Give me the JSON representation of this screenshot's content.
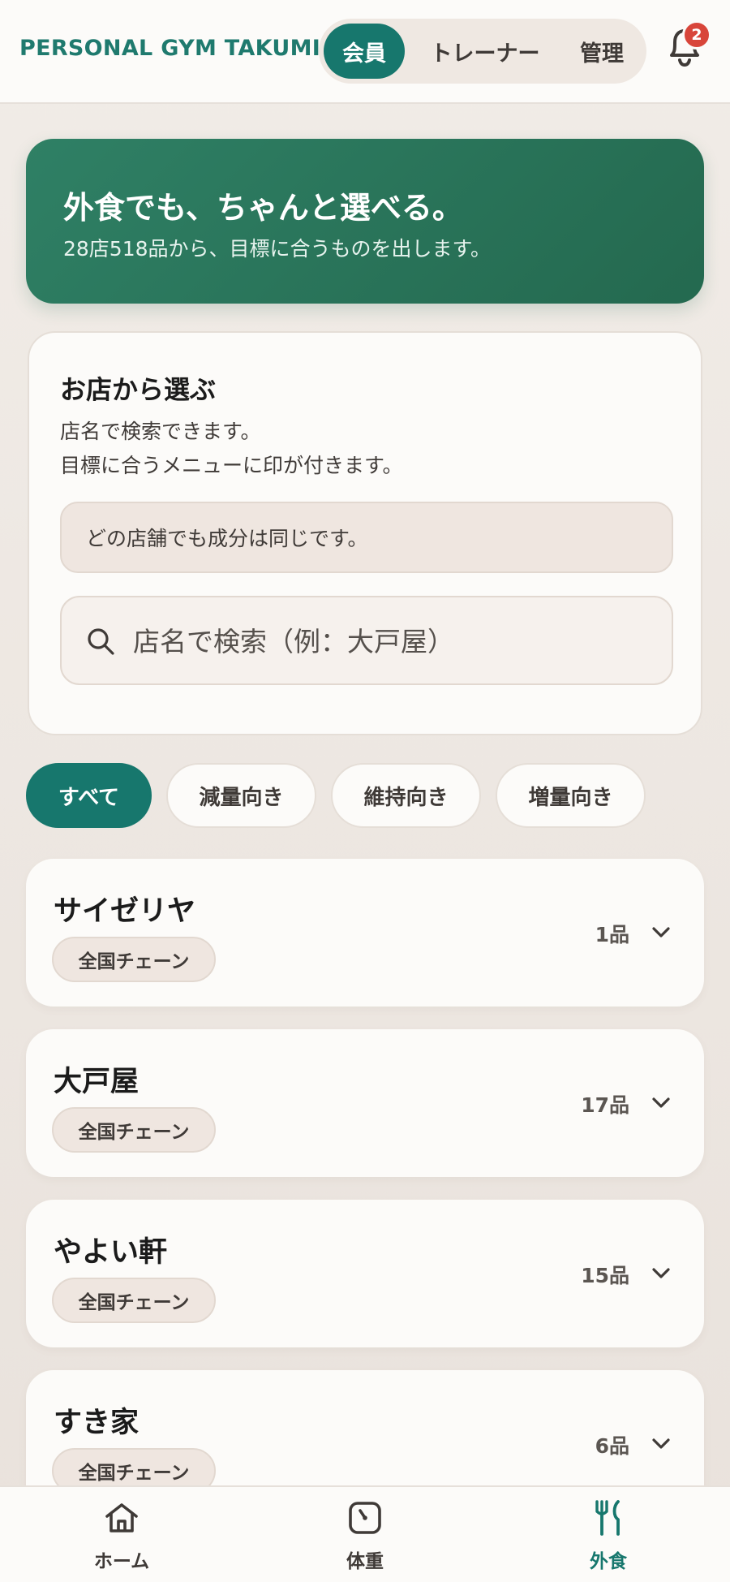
{
  "header": {
    "brand": "PERSONAL GYM TAKUMI",
    "tabs": [
      {
        "label": "会員",
        "active": true
      },
      {
        "label": "トレーナー",
        "active": false
      },
      {
        "label": "管理",
        "active": false
      }
    ],
    "notification_count": "2"
  },
  "hero": {
    "title": "外食でも、ちゃんと選べる。",
    "subtitle": "28店518品から、目標に合うものを出します。"
  },
  "store_picker": {
    "title": "お店から選ぶ",
    "line1": "店名で検索できます。",
    "line2": "目標に合うメニューに印が付きます。",
    "notice": "どの店舗でも成分は同じです。",
    "search_placeholder": "店名で検索（例：大戸屋）"
  },
  "filters": [
    {
      "label": "すべて",
      "active": true
    },
    {
      "label": "減量向き",
      "active": false
    },
    {
      "label": "維持向き",
      "active": false
    },
    {
      "label": "増量向き",
      "active": false
    }
  ],
  "stores": [
    {
      "name": "サイゼリヤ",
      "tag": "全国チェーン",
      "count": "1品"
    },
    {
      "name": "大戸屋",
      "tag": "全国チェーン",
      "count": "17品"
    },
    {
      "name": "やよい軒",
      "tag": "全国チェーン",
      "count": "15品"
    },
    {
      "name": "すき家",
      "tag": "全国チェーン",
      "count": "6品"
    }
  ],
  "bottom_nav": [
    {
      "label": "ホーム",
      "icon": "home-icon",
      "active": false
    },
    {
      "label": "体重",
      "icon": "scale-icon",
      "active": false
    },
    {
      "label": "外食",
      "icon": "fork-knife-icon",
      "active": true
    }
  ],
  "colors": {
    "accent": "#17776d",
    "hero": "#2b7a5f",
    "badge": "#d8453a",
    "background": "#efe9e4"
  }
}
